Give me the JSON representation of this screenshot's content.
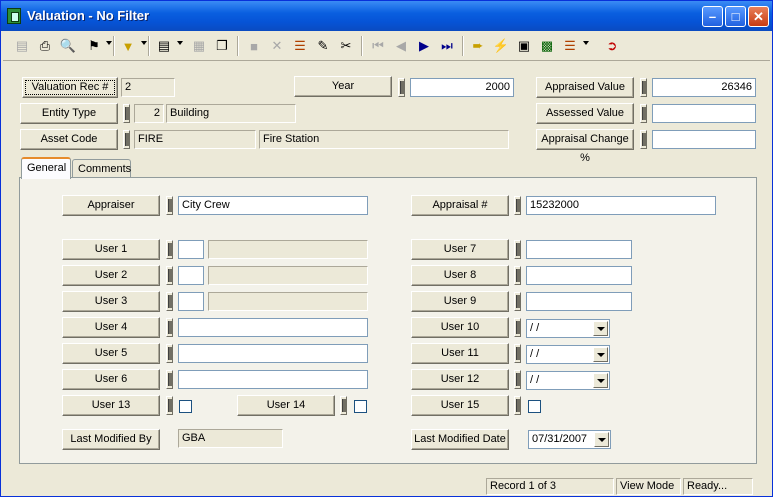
{
  "window": {
    "title": "Valuation - No Filter"
  },
  "header": {
    "valuation_rec_label": "Valuation Rec #",
    "valuation_rec_value": "2",
    "entity_type_label": "Entity Type",
    "entity_type_code": "2",
    "entity_type_name": "Building",
    "asset_code_label": "Asset Code",
    "asset_code_value": "FIRE",
    "asset_code_desc": "Fire Station",
    "year_label": "Year",
    "year_value": "2000",
    "appraised_value_label": "Appraised Value",
    "appraised_value": "26346",
    "assessed_value_label": "Assessed Value",
    "assessed_value": "",
    "appraisal_change_label": "Appraisal Change %",
    "appraisal_change_value": ""
  },
  "tabs": [
    {
      "label": "General",
      "active": true
    },
    {
      "label": "Comments",
      "active": false
    }
  ],
  "general": {
    "appraiser_label": "Appraiser",
    "appraiser_value": "City Crew",
    "appraisal_no_label": "Appraisal #",
    "appraisal_no_value": "15232000",
    "user1_label": "User 1",
    "user2_label": "User 2",
    "user3_label": "User 3",
    "user4_label": "User 4",
    "user5_label": "User 5",
    "user6_label": "User 6",
    "user7_label": "User 7",
    "user8_label": "User 8",
    "user9_label": "User 9",
    "user10_label": "User 10",
    "user10_value": " / /",
    "user11_label": "User 11",
    "user11_value": " / /",
    "user12_label": "User 12",
    "user12_value": " / /",
    "user13_label": "User 13",
    "user14_label": "User 14",
    "user15_label": "User 15",
    "last_modified_by_label": "Last Modified By",
    "last_modified_by_value": "GBA",
    "last_modified_date_label": "Last Modified Date",
    "last_modified_date_value": "07/31/2007"
  },
  "status": {
    "record": "Record 1 of 3",
    "mode": "View Mode",
    "state": "Ready..."
  },
  "colors": {
    "title_bar": "#0653d6",
    "tab_highlight": "#e68b2c"
  }
}
